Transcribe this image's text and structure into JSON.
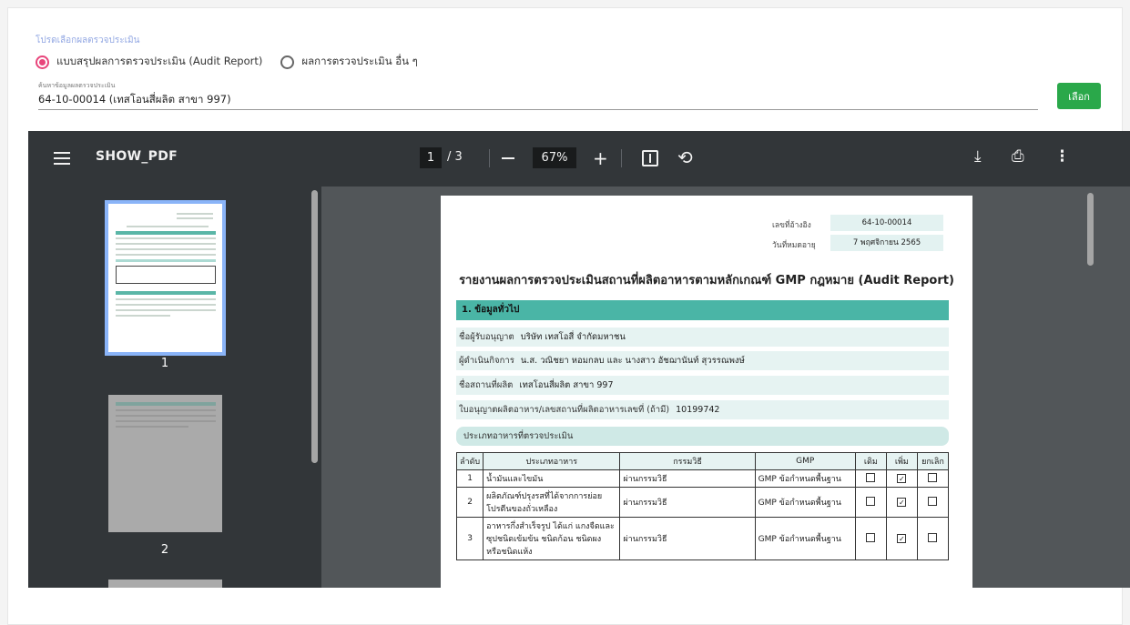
{
  "form": {
    "section_label": "โปรดเลือกผลตรวจประเมิน",
    "radio_audit_label": "แบบสรุปผลการตรวจประเมิน (Audit Report)",
    "radio_other_label": "ผลการตรวจประเมิน อื่น ๆ",
    "search_label": "ค้นหาข้อมูลผลตรวจประเมิน",
    "search_value": "64-10-00014 (เทสโอนสี่ผลิต สาขา 997)",
    "select_button": "เลือก"
  },
  "viewer": {
    "title": "SHOW_PDF",
    "current_page": "1",
    "total_pages": "/ 3",
    "zoom": "67%",
    "thumbnail_labels": [
      "1",
      "2"
    ]
  },
  "document": {
    "ref_label": "เลขที่อ้างอิง",
    "ref_value": "64-10-00014",
    "expiry_label": "วันที่หมดอายุ",
    "expiry_value": "7 พฤศจิกายน 2565",
    "title": "รายงานผลการตรวจประเมินสถานที่ผลิตอาหารตามหลักเกณฑ์ GMP กฎหมาย (Audit Report)",
    "section1": "1. ข้อมูลทั่วไป",
    "licensee_label": "ชื่อผู้รับอนุญาต",
    "licensee_value": "บริษัท เทสโอสี่ จำกัดมหาชน",
    "operator_label": "ผู้ดำเนินกิจการ",
    "operator_value": "น.ส. วณิชยา หอมกลบ และ นางสาว อัชฌานันท์ สุวรรณพงษ์",
    "plant_label": "ชื่อสถานที่ผลิต",
    "plant_value": "เทสโอนสี่ผลิต สาขา 997",
    "license_label": "ใบอนุญาตผลิตอาหาร/เลขสถานที่ผลิตอาหารเลขที่ (ถ้ามี)",
    "license_value": "10199742",
    "types_label": "ประเภทอาหารที่ตรวจประเมิน",
    "table_headers": [
      "ลำดับ",
      "ประเภทอาหาร",
      "กรรมวิธี",
      "GMP",
      "เดิม",
      "เพิ่ม",
      "ยกเลิก"
    ],
    "rows": [
      {
        "no": "1",
        "type": "น้ำมันและไขมัน",
        "process": "ผ่านกรรมวิธี",
        "gmp": "GMP ข้อกำหนดพื้นฐาน",
        "old": false,
        "add": true,
        "cancel": false
      },
      {
        "no": "2",
        "type": "ผลิตภัณฑ์ปรุงรสที่ได้จากการย่อยโปรตีนของถั่วเหลือง",
        "process": "ผ่านกรรมวิธี",
        "gmp": "GMP ข้อกำหนดพื้นฐาน",
        "old": false,
        "add": true,
        "cancel": false
      },
      {
        "no": "3",
        "type": "อาหารกึ่งสำเร็จรูป ได้แก่ แกงจืดและซุปชนิดเข้มข้น ชนิดก้อน ชนิดผง หรือชนิดแห้ง",
        "process": "ผ่านกรรมวิธี",
        "gmp": "GMP ข้อกำหนดพื้นฐาน",
        "old": false,
        "add": true,
        "cancel": false
      }
    ]
  },
  "colors": {
    "accent_pink": "#e8457b",
    "button_green": "#2aa84a",
    "teal_header": "#4ab5a6",
    "thumb_highlight": "#8ab4f8"
  }
}
